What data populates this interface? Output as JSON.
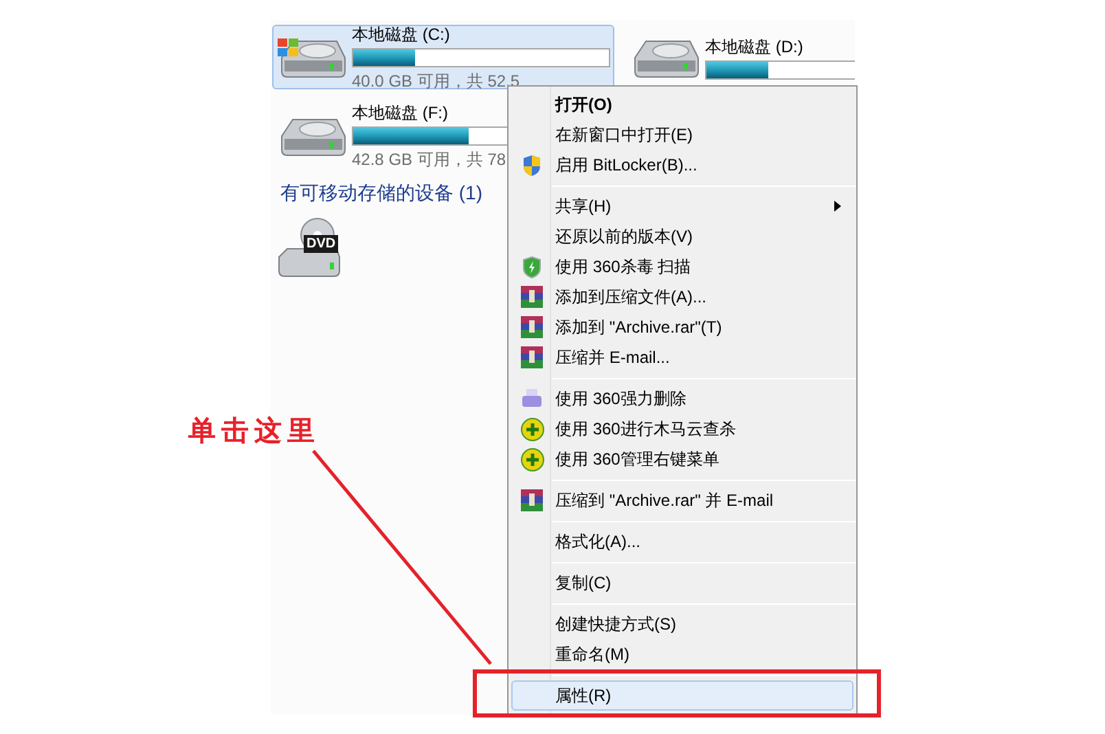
{
  "drives": [
    {
      "name": "本地磁盘 (C:)",
      "level": 0.24,
      "size": "40.0 GB 可用，共 52.5",
      "selected": true,
      "kind": "system"
    },
    {
      "name": "本地磁盘 (D:)",
      "level": 0.24,
      "selected": false,
      "kind": "disk"
    },
    {
      "name": "本地磁盘 (F:)",
      "level": 0.45,
      "size": "42.8 GB 可用，共 78",
      "selected": false,
      "kind": "disk"
    }
  ],
  "removable_group": {
    "title": "有可移动存储的设备 (1)",
    "devices": [
      {
        "badge": "DVD"
      }
    ]
  },
  "context_menu": [
    {
      "kind": "item",
      "label": "打开(O)",
      "bold": true,
      "selected": false
    },
    {
      "kind": "item",
      "label": "在新窗口中打开(E)",
      "bold": false,
      "selected": false
    },
    {
      "kind": "bitlocker",
      "label": "启用 BitLocker(B)...",
      "bold": false,
      "selected": false
    },
    {
      "kind": "separator"
    },
    {
      "kind": "item",
      "label": "共享(H)",
      "submenu": true,
      "bold": false,
      "selected": false
    },
    {
      "kind": "item",
      "label": "还原以前的版本(V)",
      "bold": false,
      "selected": false
    },
    {
      "kind": "scan",
      "label": "使用 360杀毒 扫描",
      "bold": false,
      "selected": false
    },
    {
      "kind": "archive",
      "label": "添加到压缩文件(A)...",
      "bold": false,
      "selected": false
    },
    {
      "kind": "archive",
      "label": "添加到 \"Archive.rar\"(T)",
      "bold": false,
      "selected": false
    },
    {
      "kind": "archive",
      "label": "压缩并 E-mail...",
      "bold": false,
      "selected": false
    },
    {
      "kind": "separator"
    },
    {
      "kind": "shred",
      "label": "使用 360强力删除",
      "bold": false,
      "selected": false
    },
    {
      "kind": "cloud",
      "label": "使用 360进行木马云查杀",
      "bold": false,
      "selected": false
    },
    {
      "kind": "cloud",
      "label": "使用 360管理右键菜单",
      "bold": false,
      "selected": false
    },
    {
      "kind": "separator"
    },
    {
      "kind": "archive",
      "label": "压缩到 \"Archive.rar\" 并 E-mail",
      "bold": false,
      "selected": false
    },
    {
      "kind": "separator"
    },
    {
      "kind": "item",
      "label": "格式化(A)...",
      "bold": false,
      "selected": false
    },
    {
      "kind": "separator"
    },
    {
      "kind": "item",
      "label": "复制(C)",
      "bold": false,
      "selected": false
    },
    {
      "kind": "separator"
    },
    {
      "kind": "item",
      "label": "创建快捷方式(S)",
      "bold": false,
      "selected": false
    },
    {
      "kind": "item",
      "label": "重命名(M)",
      "bold": false,
      "selected": false
    },
    {
      "kind": "separator"
    },
    {
      "kind": "item",
      "label": "属性(R)",
      "bold": false,
      "selected": true
    }
  ],
  "annotation": {
    "text": "单击这里"
  }
}
